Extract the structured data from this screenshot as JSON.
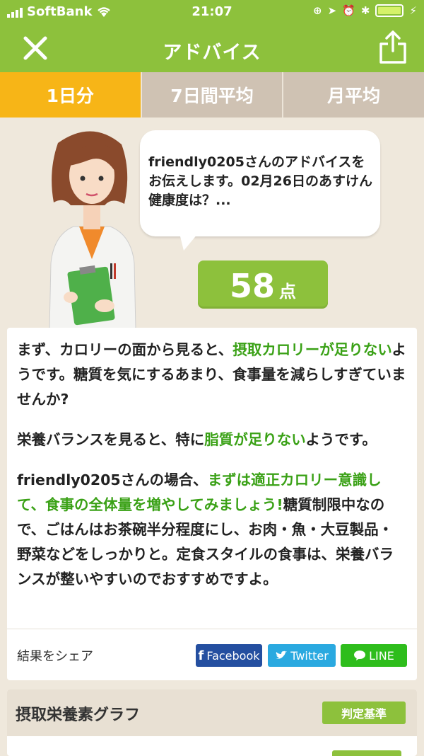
{
  "status": {
    "carrier": "SoftBank",
    "time": "21:07"
  },
  "header": {
    "title": "アドバイス"
  },
  "tabs": [
    {
      "label": "1日分",
      "active": true
    },
    {
      "label": "7日間平均",
      "active": false
    },
    {
      "label": "月平均",
      "active": false
    }
  ],
  "bubble": {
    "text": "friendly0205さんのアドバイスをお伝えします。02月26日のあすけん健康度は？..."
  },
  "score": {
    "value": "58",
    "unit": "点"
  },
  "advice": {
    "p1": {
      "a": "まず、カロリーの面から見ると、",
      "b": "摂取カロリーが足りない",
      "c": "ようです。糖質を気にするあまり、食事量を減らしすぎていませんか?"
    },
    "p2": {
      "a": "栄養バランスを見ると、特に",
      "b": "脂質が足りない",
      "c": "ようです。"
    },
    "p3": {
      "a": "friendly0205さんの場合、",
      "b": "まずは適正カロリー意識して、食事の全体量を増やしてみましょう!",
      "c": "糖質制限中なので、ごはんはお茶碗半分程度にし、お肉・魚・大豆製品・野菜などをしっかりと。定食スタイルの食事は、栄養バランスが整いやすいのでおすすめですよ。"
    }
  },
  "share": {
    "label": "結果をシェア",
    "facebook": "Facebook",
    "twitter": "Twitter",
    "line": "LINE"
  },
  "graph": {
    "title": "摂取栄養素グラフ",
    "criteria_label": "判定基準"
  },
  "colors": {
    "primary_green": "#8dc13c",
    "tab_active": "#f7b517",
    "highlight": "#3aa116",
    "facebook": "#244fa0",
    "twitter": "#2aa9e0",
    "line": "#2ebd1c"
  }
}
